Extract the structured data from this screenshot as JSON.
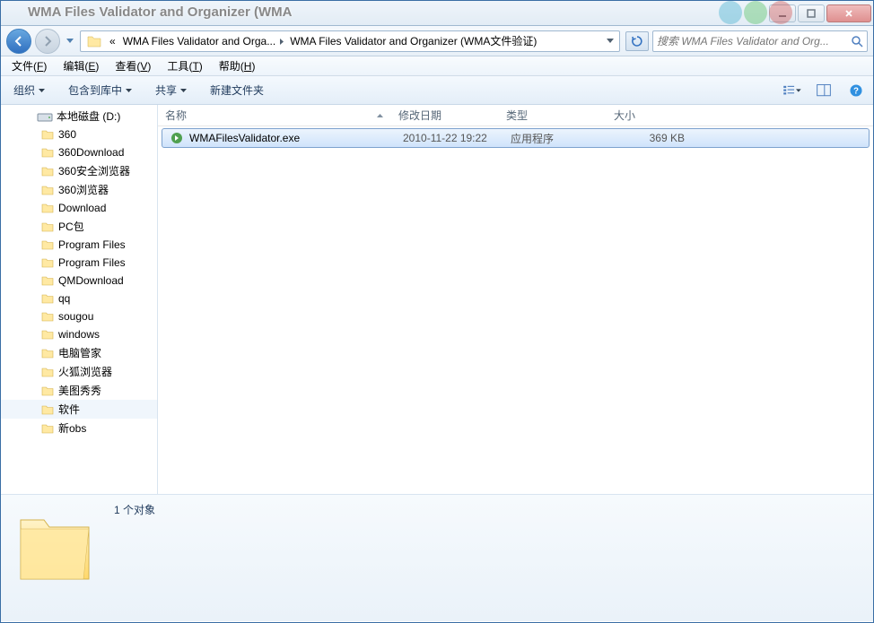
{
  "title_blur": "WMA Files Validator and Organizer (WMA",
  "breadcrumbs": {
    "prefix": "«",
    "parts": [
      "WMA Files Validator and Orga...",
      "WMA Files Validator and Organizer (WMA文件验证)"
    ]
  },
  "search_placeholder": "搜索 WMA Files Validator and Org...",
  "menubar": [
    {
      "label": "文件",
      "key": "F"
    },
    {
      "label": "编辑",
      "key": "E"
    },
    {
      "label": "查看",
      "key": "V"
    },
    {
      "label": "工具",
      "key": "T"
    },
    {
      "label": "帮助",
      "key": "H"
    }
  ],
  "toolbar": {
    "organize": "组织",
    "include": "包含到库中",
    "share": "共享",
    "newfolder": "新建文件夹"
  },
  "tree": {
    "drive": "本地磁盘 (D:)",
    "items": [
      "360",
      "360Download",
      "360安全浏览器",
      "360浏览器",
      "Download",
      "PC包",
      "Program Files",
      "Program Files",
      "QMDownload",
      "qq",
      "sougou",
      "windows",
      "电脑管家",
      "火狐浏览器",
      "美图秀秀",
      "软件",
      "新obs"
    ]
  },
  "columns": {
    "name": "名称",
    "date": "修改日期",
    "type": "类型",
    "size": "大小"
  },
  "files": [
    {
      "name": "WMAFilesValidator.exe",
      "date": "2010-11-22 19:22",
      "type": "应用程序",
      "size": "369 KB"
    }
  ],
  "details": {
    "count_label": "1 个对象"
  }
}
